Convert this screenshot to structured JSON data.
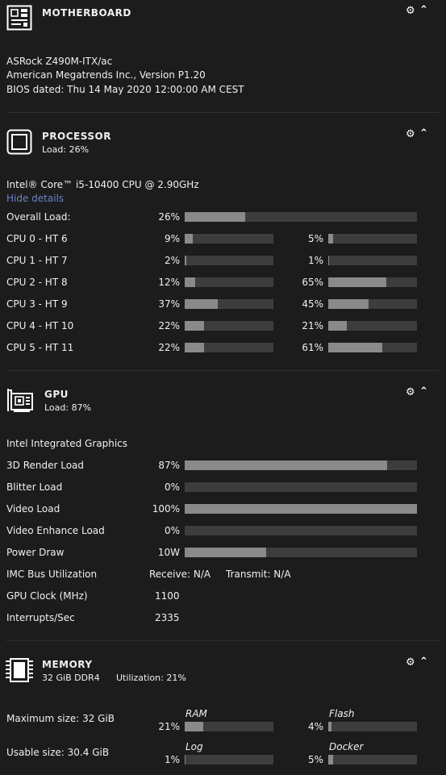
{
  "motherboard": {
    "title": "MOTHERBOARD",
    "model": "ASRock Z490M-ITX/ac",
    "bios_vendor": "American Megatrends Inc., Version P1.20",
    "bios_date": "BIOS dated: Thu 14 May 2020 12:00:00 AM CEST",
    "icon": "motherboard-icon"
  },
  "processor": {
    "title": "PROCESSOR",
    "load": "Load: 26%",
    "name": "Intel® Core™ i5-10400 CPU @ 2.90GHz",
    "hide_details": "Hide details",
    "overall_label": "Overall Load:",
    "overall_pct": "26%",
    "overall_value": 26,
    "icon": "cpu-icon",
    "cores": [
      {
        "label": "CPU 0 - HT 6",
        "p1": "9%",
        "v1": 9,
        "p2": "5%",
        "v2": 5
      },
      {
        "label": "CPU 1 - HT 7",
        "p1": "2%",
        "v1": 2,
        "p2": "1%",
        "v2": 1
      },
      {
        "label": "CPU 2 - HT 8",
        "p1": "12%",
        "v1": 12,
        "p2": "65%",
        "v2": 65
      },
      {
        "label": "CPU 3 - HT 9",
        "p1": "37%",
        "v1": 37,
        "p2": "45%",
        "v2": 45
      },
      {
        "label": "CPU 4 - HT 10",
        "p1": "22%",
        "v1": 22,
        "p2": "21%",
        "v2": 21
      },
      {
        "label": "CPU 5 - HT 11",
        "p1": "22%",
        "v1": 22,
        "p2": "61%",
        "v2": 61
      }
    ]
  },
  "gpu": {
    "title": "GPU",
    "load": "Load: 87%",
    "name": "Intel Integrated Graphics",
    "icon": "gpu-icon",
    "bars": [
      {
        "label": "3D Render Load",
        "pct": "87%",
        "value": 87
      },
      {
        "label": "Blitter Load",
        "pct": "0%",
        "value": 0
      },
      {
        "label": "Video Load",
        "pct": "100%",
        "value": 100
      },
      {
        "label": "Video Enhance Load",
        "pct": "0%",
        "value": 0
      },
      {
        "label": "Power Draw",
        "pct": "10W",
        "value": 35
      }
    ],
    "imc_label": "IMC Bus Utilization",
    "imc_receive": "Receive: N/A",
    "imc_transmit": "Transmit: N/A",
    "clock_label": "GPU Clock (MHz)",
    "clock_value": "1100",
    "irq_label": "Interrupts/Sec",
    "irq_value": "2335"
  },
  "memory": {
    "title": "MEMORY",
    "size": "32 GiB DDR4",
    "utilization": "Utilization: 21%",
    "max_size": "Maximum size: 32 GiB",
    "usable_size": "Usable size: 30.4 GiB",
    "icon": "memory-icon",
    "pools": [
      {
        "name": "RAM",
        "pct": "21%",
        "value": 21
      },
      {
        "name": "Flash",
        "pct": "4%",
        "value": 4
      },
      {
        "name": "Log",
        "pct": "1%",
        "value": 1
      },
      {
        "name": "Docker",
        "pct": "5%",
        "value": 5
      }
    ]
  },
  "controls": {
    "settings_icon": "gear-icon",
    "collapse_icon": "chevron-up-icon"
  }
}
